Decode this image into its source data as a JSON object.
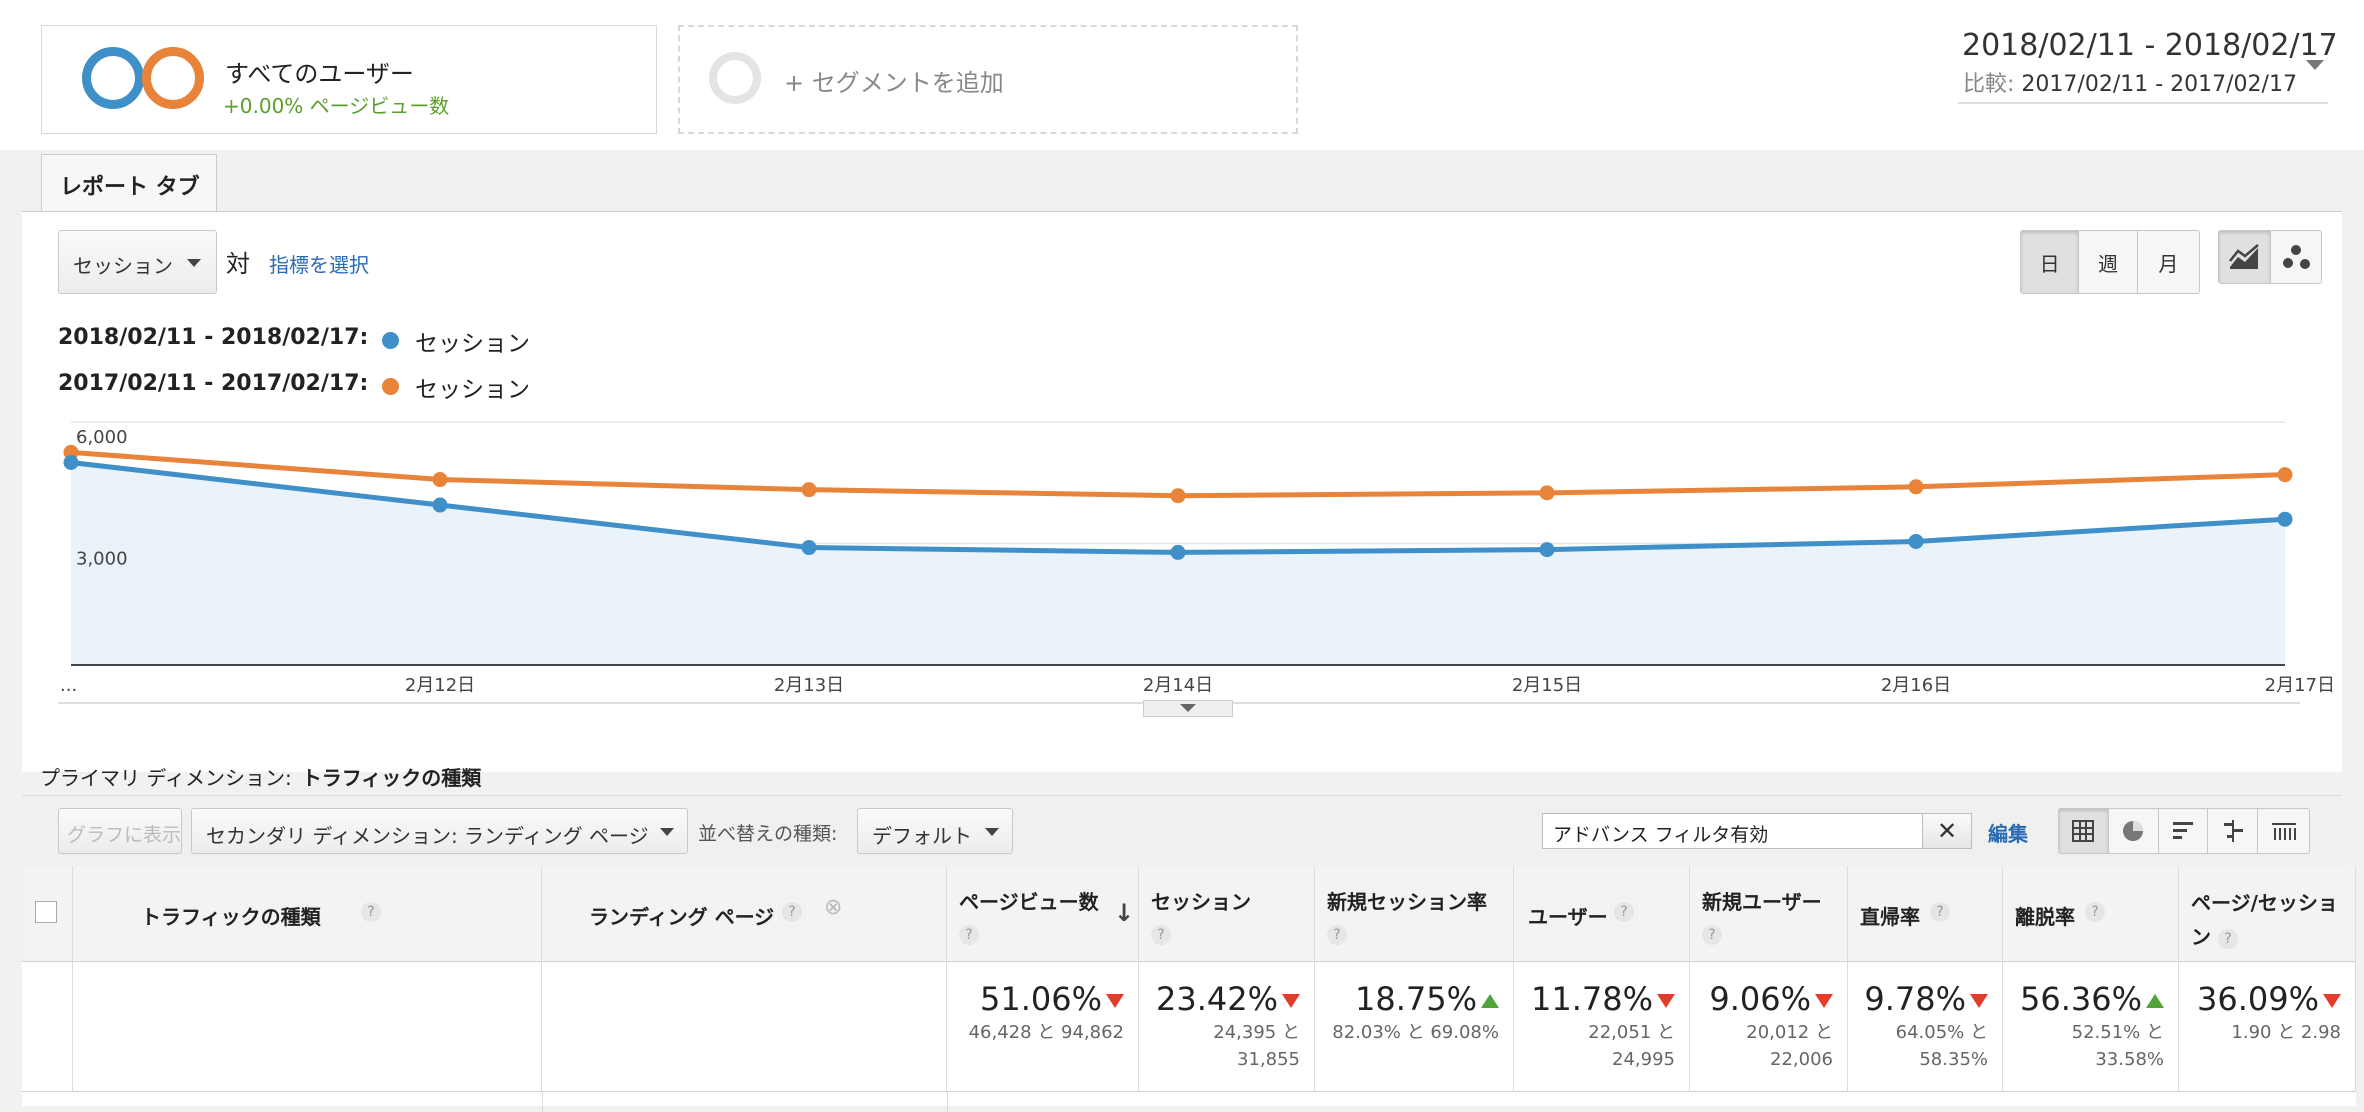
{
  "segments": {
    "all_users_title": "すべてのユーザー",
    "all_users_sub": "+0.00% ページビュー数",
    "add_label": "+ セグメントを追加"
  },
  "date": {
    "range": "2018/02/11 - 2018/02/17",
    "compare_label": "比較:",
    "compare_range": "2017/02/11 - 2017/02/17"
  },
  "tab": {
    "label": "レポート タブ"
  },
  "controls": {
    "metric_select": "セッション",
    "vs": "対",
    "choose_metric": "指標を選択",
    "day": "日",
    "week": "週",
    "month": "月"
  },
  "legend": [
    {
      "range": "2018/02/11 - 2018/02/17:",
      "label": "セッション"
    },
    {
      "range": "2017/02/11 - 2017/02/17:",
      "label": "セッション"
    }
  ],
  "colors": {
    "current": "#3f8fc8",
    "previous": "#e8833a",
    "area": "#eaf2fa",
    "positive": "#51a43a",
    "negative": "#e53b2c",
    "link": "#2a6ab3"
  },
  "chart_data": {
    "type": "line",
    "categories": [
      "...",
      "2月12日",
      "2月13日",
      "2月14日",
      "2月15日",
      "2月16日",
      "2月17日"
    ],
    "series": [
      {
        "name": "2018/02/11 - 2018/02/17: セッション",
        "values": [
          5000,
          3950,
          2900,
          2780,
          2850,
          3050,
          3600
        ]
      },
      {
        "name": "2017/02/11 - 2017/02/17: セッション",
        "values": [
          5250,
          4580,
          4330,
          4180,
          4250,
          4400,
          4700
        ]
      }
    ],
    "yticks": [
      "6,000",
      "3,000"
    ],
    "ylim": [
      0,
      6000
    ],
    "grid": true,
    "area_fill_current": true
  },
  "dimension": {
    "label": "プライマリ ディメンション:",
    "value": "トラフィックの種類"
  },
  "toolbar": {
    "show_in_graph": "グラフに表示",
    "secondary_dimension": "セカンダリ ディメンション: ランディング ページ",
    "sort_label": "並べ替えの種類:",
    "sort_value": "デフォルト",
    "filter_value": "アドバンス フィルタ有効",
    "edit": "編集"
  },
  "table": {
    "headers": {
      "traffic_type": "トラフィックの種類",
      "landing_page": "ランディング ページ",
      "pageviews": "ページビュー数",
      "sessions": "セッション",
      "new_session_rate": "新規セッション率",
      "users": "ユーザー",
      "new_users": "新規ユーザー",
      "direct_rate": "直帰率",
      "bounce_rate": "離脱率",
      "pages_per_session": "ページ/セッション"
    },
    "totals": [
      {
        "pct": "51.06%",
        "dir": "down",
        "cmp": "46,428 と 94,862"
      },
      {
        "pct": "23.42%",
        "dir": "down",
        "cmp_a": "24,395 と",
        "cmp_b": "31,855"
      },
      {
        "pct": "18.75%",
        "dir": "up",
        "cmp": "82.03% と 69.08%"
      },
      {
        "pct": "11.78%",
        "dir": "down",
        "cmp_a": "22,051 と",
        "cmp_b": "24,995"
      },
      {
        "pct": "9.06%",
        "dir": "down",
        "cmp_a": "20,012 と",
        "cmp_b": "22,006"
      },
      {
        "pct": "9.78%",
        "dir": "down",
        "cmp_a": "64.05% と",
        "cmp_b": "58.35%"
      },
      {
        "pct": "56.36%",
        "dir": "up",
        "cmp_a": "52.51% と",
        "cmp_b": "33.58%"
      },
      {
        "pct": "36.09%",
        "dir": "down",
        "cmp": "1.90 と 2.98"
      }
    ]
  }
}
